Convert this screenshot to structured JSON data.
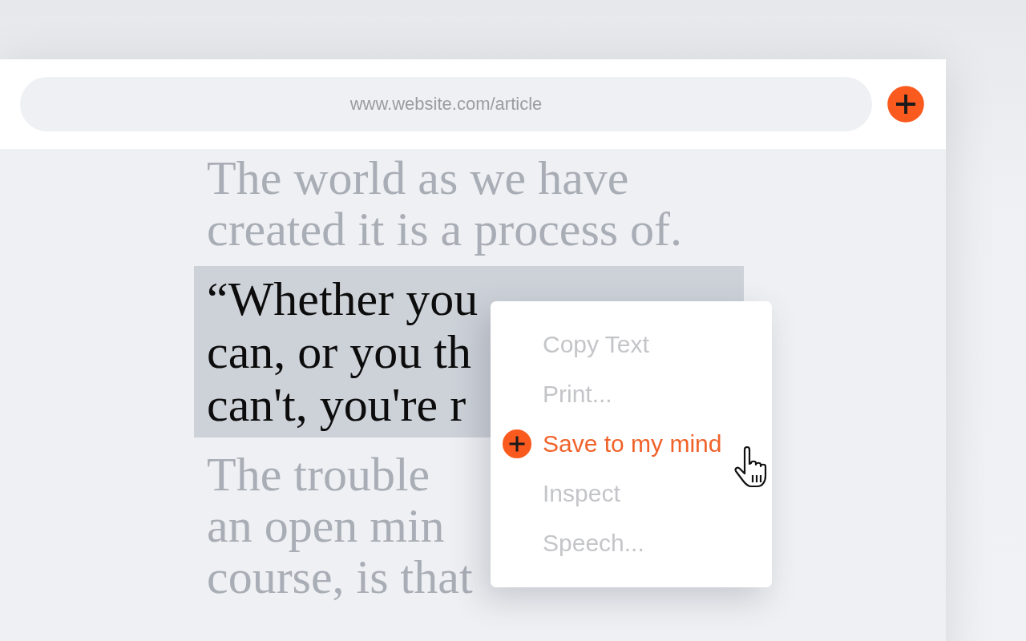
{
  "address_bar": {
    "url": "www.website.com/article"
  },
  "article": {
    "paragraphs": [
      {
        "kind": "faded",
        "lines": [
          "The world as we have",
          "created it is a process of."
        ]
      },
      {
        "kind": "highlighted",
        "lines": [
          "“Whether you",
          "can, or you th",
          "can't, you're r"
        ]
      },
      {
        "kind": "faded",
        "lines": [
          "The trouble",
          "an open min",
          "course, is that"
        ]
      }
    ]
  },
  "context_menu": {
    "items": [
      {
        "label": "Copy Text",
        "selected": false
      },
      {
        "label": "Print...",
        "selected": false
      },
      {
        "label": "Save to my mind",
        "selected": true
      },
      {
        "label": "Inspect",
        "selected": false
      },
      {
        "label": "Speech...",
        "selected": false
      }
    ]
  }
}
